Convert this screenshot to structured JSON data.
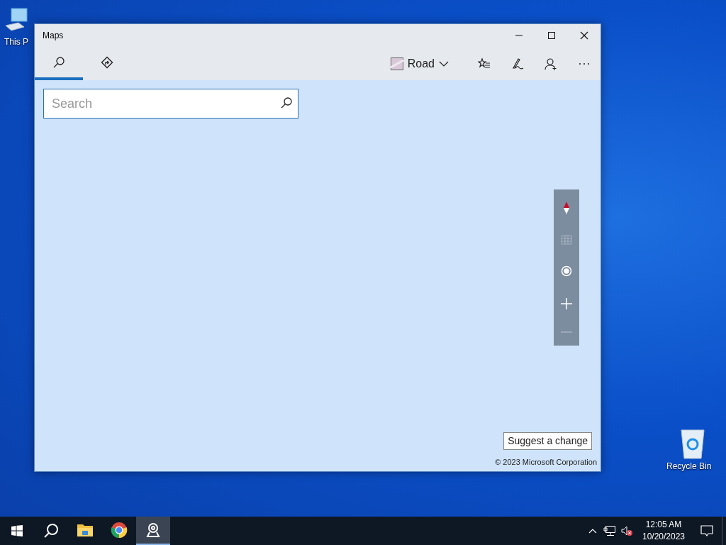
{
  "desktop_icons": [
    {
      "kind": "computer",
      "label": "This P"
    },
    {
      "kind": "recycle",
      "label": "Recycle Bin"
    }
  ],
  "window": {
    "title": "Maps"
  },
  "nav_tabs": [
    {
      "kind": "search",
      "selected": true
    },
    {
      "kind": "directions",
      "selected": false
    }
  ],
  "map_style": {
    "label": "Road"
  },
  "search": {
    "placeholder": "Search"
  },
  "suggest_button": "Suggest a change",
  "copyright": "© 2023 Microsoft Corporation",
  "taskbar": {
    "apps": [
      {
        "kind": "explorer",
        "selected": false
      },
      {
        "kind": "chrome",
        "selected": false
      },
      {
        "kind": "maps",
        "selected": true
      }
    ]
  },
  "clock": {
    "time": "12:05 AM",
    "date": "10/20/2023"
  }
}
